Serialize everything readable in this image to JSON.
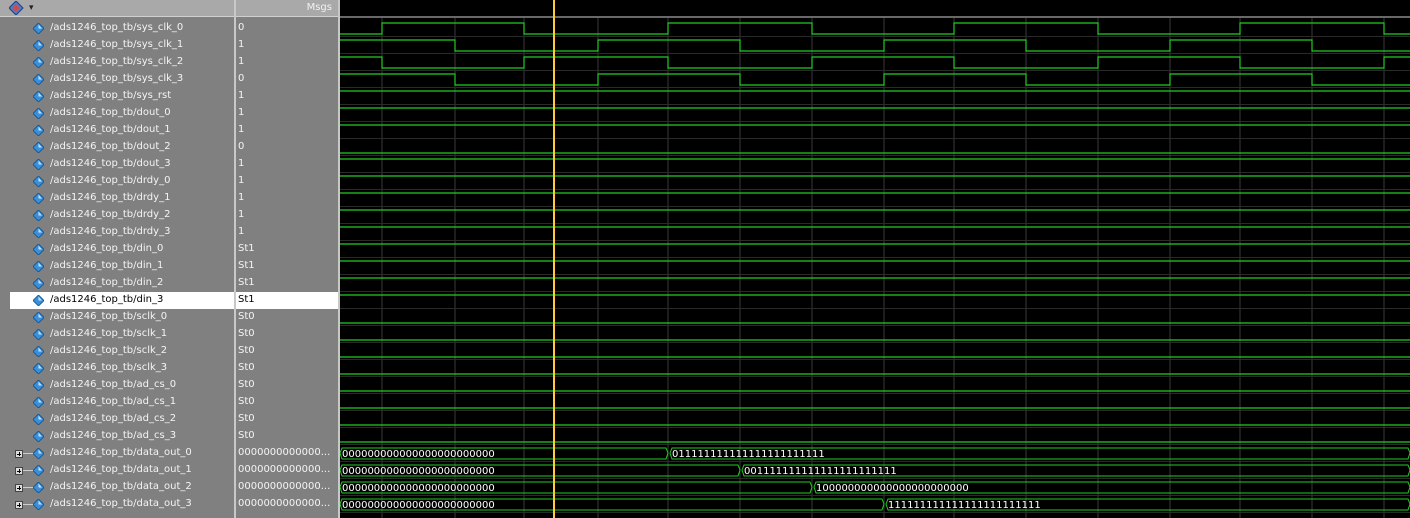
{
  "header": {
    "values_title": "Msgs",
    "menu_icon": "wave-menu-icon",
    "menu_caret": "▾"
  },
  "colors": {
    "wave": "#22cc22",
    "cursor": "#ffcc33",
    "grid": "#3a3a3a",
    "bus_text": "#ffffff"
  },
  "signals": [
    {
      "name": "/ads1246_top_tb/sys_clk_0",
      "value": "0",
      "type": "bit"
    },
    {
      "name": "/ads1246_top_tb/sys_clk_1",
      "value": "1",
      "type": "bit"
    },
    {
      "name": "/ads1246_top_tb/sys_clk_2",
      "value": "1",
      "type": "bit"
    },
    {
      "name": "/ads1246_top_tb/sys_clk_3",
      "value": "0",
      "type": "bit"
    },
    {
      "name": "/ads1246_top_tb/sys_rst",
      "value": "1",
      "type": "bit"
    },
    {
      "name": "/ads1246_top_tb/dout_0",
      "value": "1",
      "type": "bit"
    },
    {
      "name": "/ads1246_top_tb/dout_1",
      "value": "1",
      "type": "bit"
    },
    {
      "name": "/ads1246_top_tb/dout_2",
      "value": "0",
      "type": "bit"
    },
    {
      "name": "/ads1246_top_tb/dout_3",
      "value": "1",
      "type": "bit"
    },
    {
      "name": "/ads1246_top_tb/drdy_0",
      "value": "1",
      "type": "bit"
    },
    {
      "name": "/ads1246_top_tb/drdy_1",
      "value": "1",
      "type": "bit"
    },
    {
      "name": "/ads1246_top_tb/drdy_2",
      "value": "1",
      "type": "bit"
    },
    {
      "name": "/ads1246_top_tb/drdy_3",
      "value": "1",
      "type": "bit"
    },
    {
      "name": "/ads1246_top_tb/din_0",
      "value": "St1",
      "type": "bit"
    },
    {
      "name": "/ads1246_top_tb/din_1",
      "value": "St1",
      "type": "bit"
    },
    {
      "name": "/ads1246_top_tb/din_2",
      "value": "St1",
      "type": "bit"
    },
    {
      "name": "/ads1246_top_tb/din_3",
      "value": "St1",
      "type": "bit",
      "selected": true
    },
    {
      "name": "/ads1246_top_tb/sclk_0",
      "value": "St0",
      "type": "bit"
    },
    {
      "name": "/ads1246_top_tb/sclk_1",
      "value": "St0",
      "type": "bit"
    },
    {
      "name": "/ads1246_top_tb/sclk_2",
      "value": "St0",
      "type": "bit"
    },
    {
      "name": "/ads1246_top_tb/sclk_3",
      "value": "St0",
      "type": "bit"
    },
    {
      "name": "/ads1246_top_tb/ad_cs_0",
      "value": "St0",
      "type": "bit"
    },
    {
      "name": "/ads1246_top_tb/ad_cs_1",
      "value": "St0",
      "type": "bit"
    },
    {
      "name": "/ads1246_top_tb/ad_cs_2",
      "value": "St0",
      "type": "bit"
    },
    {
      "name": "/ads1246_top_tb/ad_cs_3",
      "value": "St0",
      "type": "bit"
    },
    {
      "name": "/ads1246_top_tb/data_out_0",
      "value": "0000000000000...",
      "type": "bus"
    },
    {
      "name": "/ads1246_top_tb/data_out_1",
      "value": "0000000000000...",
      "type": "bus"
    },
    {
      "name": "/ads1246_top_tb/data_out_2",
      "value": "0000000000000...",
      "type": "bus"
    },
    {
      "name": "/ads1246_top_tb/data_out_3",
      "value": "0000000000000...",
      "type": "bus"
    }
  ],
  "waves": {
    "sys_clk": [
      {
        "start": 0,
        "toggles": [
          382,
          524,
          668,
          812,
          954,
          1098,
          1240,
          1384
        ]
      },
      {
        "start": 1,
        "toggles": [
          455,
          598,
          740,
          884,
          1026,
          1170,
          1312
        ]
      },
      {
        "start": 1,
        "toggles": [
          382,
          524,
          668,
          812,
          954,
          1098,
          1240,
          1384
        ]
      },
      {
        "start": 1,
        "toggles": [
          455,
          598,
          740,
          884,
          1026,
          1170,
          1312
        ]
      }
    ],
    "bus_segments": [
      [
        {
          "from": 340,
          "to": 668,
          "text": "000000000000000000000000"
        },
        {
          "from": 668,
          "to": 1410,
          "text": "011111111111111111111111"
        }
      ],
      [
        {
          "from": 340,
          "to": 740,
          "text": "000000000000000000000000"
        },
        {
          "from": 740,
          "to": 1410,
          "text": "001111111111111111111111"
        }
      ],
      [
        {
          "from": 340,
          "to": 812,
          "text": "000000000000000000000000"
        },
        {
          "from": 812,
          "to": 1410,
          "text": "100000000000000000000000"
        }
      ],
      [
        {
          "from": 340,
          "to": 884,
          "text": "000000000000000000000000"
        },
        {
          "from": 884,
          "to": 1410,
          "text": "111111111111111111111111"
        }
      ]
    ]
  }
}
